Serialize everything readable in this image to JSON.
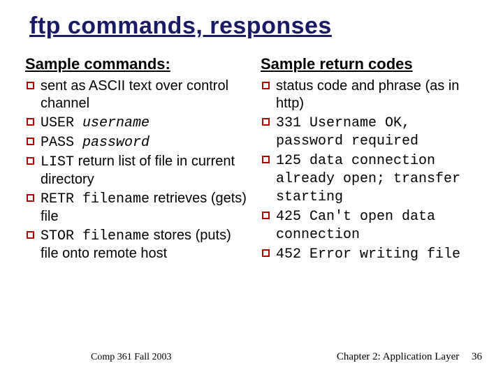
{
  "title": "ftp commands, responses",
  "left": {
    "heading": "Sample commands:",
    "items": [
      {
        "parts": [
          {
            "text": "sent as ASCII text over control channel"
          }
        ]
      },
      {
        "parts": [
          {
            "text": "USER ",
            "mono": true
          },
          {
            "text": "username",
            "mono": true,
            "italic": true
          }
        ]
      },
      {
        "parts": [
          {
            "text": "PASS ",
            "mono": true
          },
          {
            "text": "password",
            "mono": true,
            "italic": true
          }
        ]
      },
      {
        "parts": [
          {
            "text": "LIST",
            "mono": true
          },
          {
            "text": " return list of file in current directory"
          }
        ]
      },
      {
        "parts": [
          {
            "text": "RETR filename",
            "mono": true
          },
          {
            "text": " retrieves (gets) file"
          }
        ]
      },
      {
        "parts": [
          {
            "text": "STOR filename",
            "mono": true
          },
          {
            "text": " stores (puts) file onto remote host"
          }
        ]
      }
    ]
  },
  "right": {
    "heading": "Sample return codes",
    "items": [
      {
        "parts": [
          {
            "text": "status code and phrase (as in http)"
          }
        ]
      },
      {
        "parts": [
          {
            "text": "331 Username OK, password required",
            "mono": true
          }
        ]
      },
      {
        "parts": [
          {
            "text": "125 data connection already open; transfer starting",
            "mono": true
          }
        ]
      },
      {
        "parts": [
          {
            "text": "425 Can't open data connection",
            "mono": true
          }
        ]
      },
      {
        "parts": [
          {
            "text": "452 Error writing file",
            "mono": true
          }
        ]
      }
    ]
  },
  "footer": {
    "left": "Comp 361   Fall 2003",
    "right_label": "Chapter 2: Application Layer",
    "right_page": "36"
  }
}
